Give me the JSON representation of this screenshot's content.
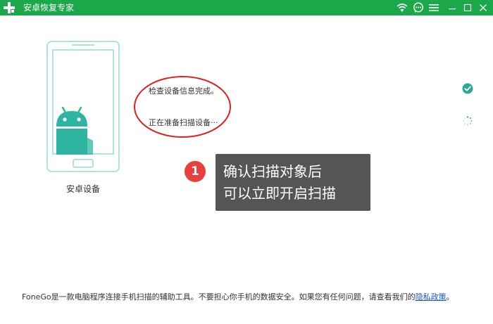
{
  "window": {
    "title": "安卓恢复专家",
    "accent": "#1aa84a"
  },
  "titlebar": {
    "logo_icon": "plus-cross-icon",
    "buttons": [
      "wifi-icon",
      "chat-icon",
      "menu-icon",
      "minimize-icon",
      "restore-icon",
      "close-icon"
    ]
  },
  "device": {
    "label": "安卓设备",
    "icon": "android-robot-icon"
  },
  "status": {
    "check_complete": "检查设备信息完成。",
    "preparing_scan": "正在准备扫描设备···",
    "done_icon": "check-circle-icon",
    "pending_icon": "loading-spinner-icon"
  },
  "tooltip": {
    "step_number": "1",
    "line1": "确认扫描对象后",
    "line2": "可以立即开启扫描",
    "badge_color": "#e8403c"
  },
  "footer": {
    "text": "FoneGo是一款电脑程序连接手机扫描的辅助工具。不要担心你手机的数据安全。如果您有任何问题，请查看我们的",
    "link": "隐私政策",
    "end": "。"
  }
}
